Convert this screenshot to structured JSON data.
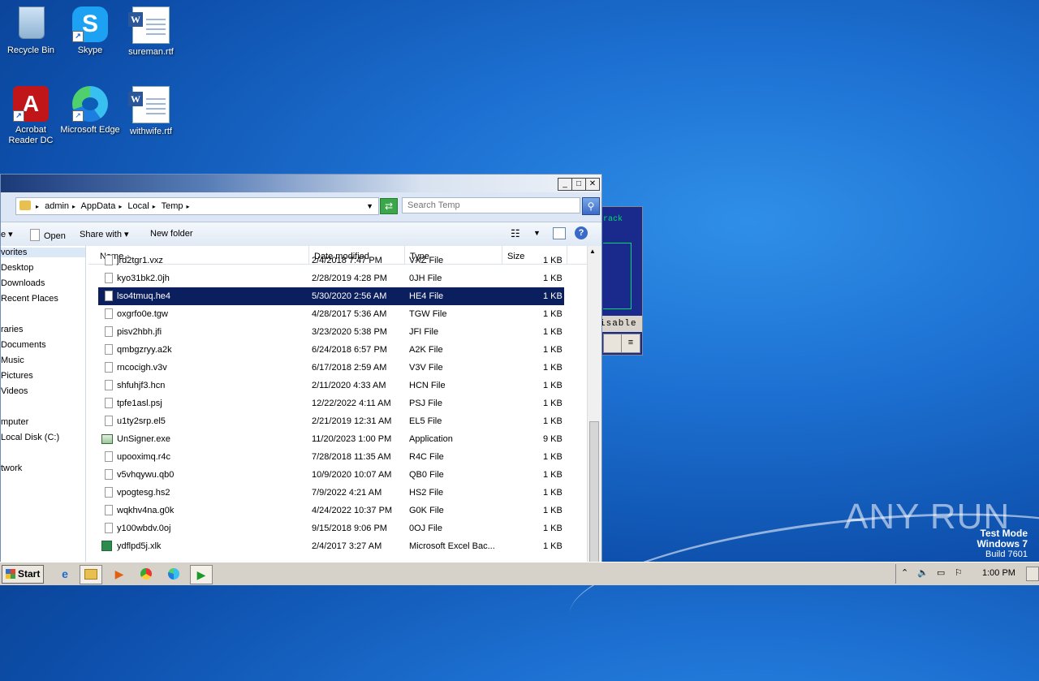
{
  "desktop": {
    "icons": [
      {
        "label": "Recycle Bin"
      },
      {
        "label": "Skype"
      },
      {
        "label": "sureman.rtf"
      },
      {
        "label": "Acrobat Reader DC"
      },
      {
        "label": "Microsoft Edge"
      },
      {
        "label": "withwife.rtf"
      }
    ]
  },
  "bg_window": {
    "text1": "rack",
    "disable_text": "isable",
    "menu_glyph": "≡"
  },
  "explorer": {
    "window_buttons": {
      "minimize": "_",
      "maximize": "□",
      "close": "✕"
    },
    "breadcrumb": [
      "admin",
      "AppData",
      "Local",
      "Temp"
    ],
    "search_placeholder": "Search Temp",
    "toolbar": {
      "first": "e",
      "open": "Open",
      "share_with": "Share with",
      "new_folder": "New folder"
    },
    "nav": [
      "vorites",
      "Desktop",
      "Downloads",
      "Recent Places",
      "raries",
      "Documents",
      "Music",
      "Pictures",
      "Videos",
      "mputer",
      "Local Disk (C:)",
      "twork"
    ],
    "columns": {
      "name": "Name",
      "date": "Date modified",
      "type": "Type",
      "size": "Size"
    },
    "files": [
      {
        "name": "jrd2tgr1.vxz",
        "date": "2/4/2018 7:47 PM",
        "type": "VXZ File",
        "size": "1 KB",
        "icon": "file"
      },
      {
        "name": "kyo31bk2.0jh",
        "date": "2/28/2019 4:28 PM",
        "type": "0JH File",
        "size": "1 KB",
        "icon": "file"
      },
      {
        "name": "lso4tmuq.he4",
        "date": "5/30/2020 2:56 AM",
        "type": "HE4 File",
        "size": "1 KB",
        "icon": "file"
      },
      {
        "name": "oxgrfo0e.tgw",
        "date": "4/28/2017 5:36 AM",
        "type": "TGW File",
        "size": "1 KB",
        "icon": "file"
      },
      {
        "name": "pisv2hbh.jfi",
        "date": "3/23/2020 5:38 PM",
        "type": "JFI File",
        "size": "1 KB",
        "icon": "file"
      },
      {
        "name": "qmbgzryy.a2k",
        "date": "6/24/2018 6:57 PM",
        "type": "A2K File",
        "size": "1 KB",
        "icon": "file"
      },
      {
        "name": "rncocigh.v3v",
        "date": "6/17/2018 2:59 AM",
        "type": "V3V File",
        "size": "1 KB",
        "icon": "file"
      },
      {
        "name": "shfuhjf3.hcn",
        "date": "2/11/2020 4:33 AM",
        "type": "HCN File",
        "size": "1 KB",
        "icon": "file"
      },
      {
        "name": "tpfe1asl.psj",
        "date": "12/22/2022 4:11 AM",
        "type": "PSJ File",
        "size": "1 KB",
        "icon": "file"
      },
      {
        "name": "u1ty2srp.el5",
        "date": "2/21/2019 12:31 AM",
        "type": "EL5 File",
        "size": "1 KB",
        "icon": "file"
      },
      {
        "name": "UnSigner.exe",
        "date": "11/20/2023 1:00 PM",
        "type": "Application",
        "size": "9 KB",
        "icon": "app"
      },
      {
        "name": "upooximq.r4c",
        "date": "7/28/2018 11:35 AM",
        "type": "R4C File",
        "size": "1 KB",
        "icon": "file"
      },
      {
        "name": "v5vhqywu.qb0",
        "date": "10/9/2020 10:07 AM",
        "type": "QB0 File",
        "size": "1 KB",
        "icon": "file"
      },
      {
        "name": "vpogtesg.hs2",
        "date": "7/9/2022 4:21 AM",
        "type": "HS2 File",
        "size": "1 KB",
        "icon": "file"
      },
      {
        "name": "wqkhv4na.g0k",
        "date": "4/24/2022 10:37 PM",
        "type": "G0K File",
        "size": "1 KB",
        "icon": "file"
      },
      {
        "name": "y100wbdv.0oj",
        "date": "9/15/2018 9:06 PM",
        "type": "0OJ File",
        "size": "1 KB",
        "icon": "file"
      },
      {
        "name": "ydflpd5j.xlk",
        "date": "2/4/2017 3:27 AM",
        "type": "Microsoft Excel Bac...",
        "size": "1 KB",
        "icon": "xls"
      }
    ],
    "selected_file_index": 2
  },
  "taskbar": {
    "start_label": "Start",
    "clock": "1:00 PM"
  },
  "watermark": {
    "line1": "Test Mode",
    "line2": "Windows 7",
    "line3": "Build 7601",
    "brand": "ANY RUN"
  },
  "colors": {
    "selection": "#0b1f5e",
    "desktop": "#1c6fd0"
  }
}
